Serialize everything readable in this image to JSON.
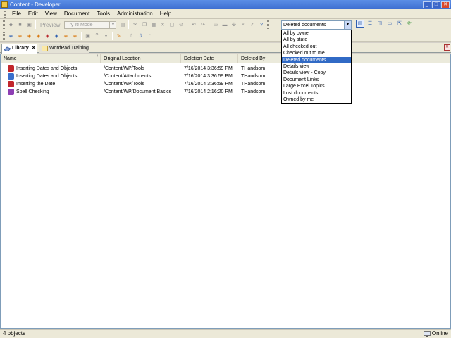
{
  "window": {
    "title": "Content - Developer",
    "buttons": {
      "minimize": "_",
      "maximize": "□",
      "close": "✕"
    }
  },
  "menu": [
    "File",
    "Edit",
    "View",
    "Document",
    "Tools",
    "Administration",
    "Help"
  ],
  "toolbar": {
    "preview_label": "Preview",
    "mode_combo": "Try It! Mode",
    "view_combo": "Deleted documents",
    "combo_arrow": "▼"
  },
  "tabs": [
    {
      "label": "Library",
      "close": "✕"
    },
    {
      "label": "WordPad Training"
    }
  ],
  "panel_close": "✕",
  "list": {
    "columns": [
      "Name",
      "Original Location",
      "Deletion Date",
      "Deleted By"
    ],
    "sort_indicator": "/",
    "rows": [
      {
        "name": "Inserting Dates and Objects",
        "location": "/Content/WP/Tools",
        "date": "7/16/2014 3:36:59 PM",
        "by": "THandsom",
        "icon_color": "#c2262b"
      },
      {
        "name": "Inserting Dates and Objects",
        "location": "/Content/Attachments",
        "date": "7/16/2014 3:36:59 PM",
        "by": "THandsom",
        "icon_color": "#3a6fcc"
      },
      {
        "name": "Inserting the Date",
        "location": "/Content/WP/Tools",
        "date": "7/16/2014 3:36:59 PM",
        "by": "THandsom",
        "icon_color": "#c2262b"
      },
      {
        "name": "Spell Checking",
        "location": "/Content/WP/Document Basics",
        "date": "7/16/2014 2:16:20 PM",
        "by": "THandsom",
        "icon_color": "#8e3fb4"
      }
    ]
  },
  "dropdown": {
    "items": [
      "All by owner",
      "All by state",
      "All checked out",
      "Checked out to me",
      "Deleted documents",
      "Details view",
      "Details view - Copy",
      "Document Links",
      "Large Excel Topics",
      "Lost documents",
      "Owned by me"
    ],
    "selected_index": 4
  },
  "status": {
    "count": "4 objects",
    "connection": "Online"
  },
  "colors": {
    "selection": "#316ac5",
    "titlebar": "#3e6fd1"
  }
}
